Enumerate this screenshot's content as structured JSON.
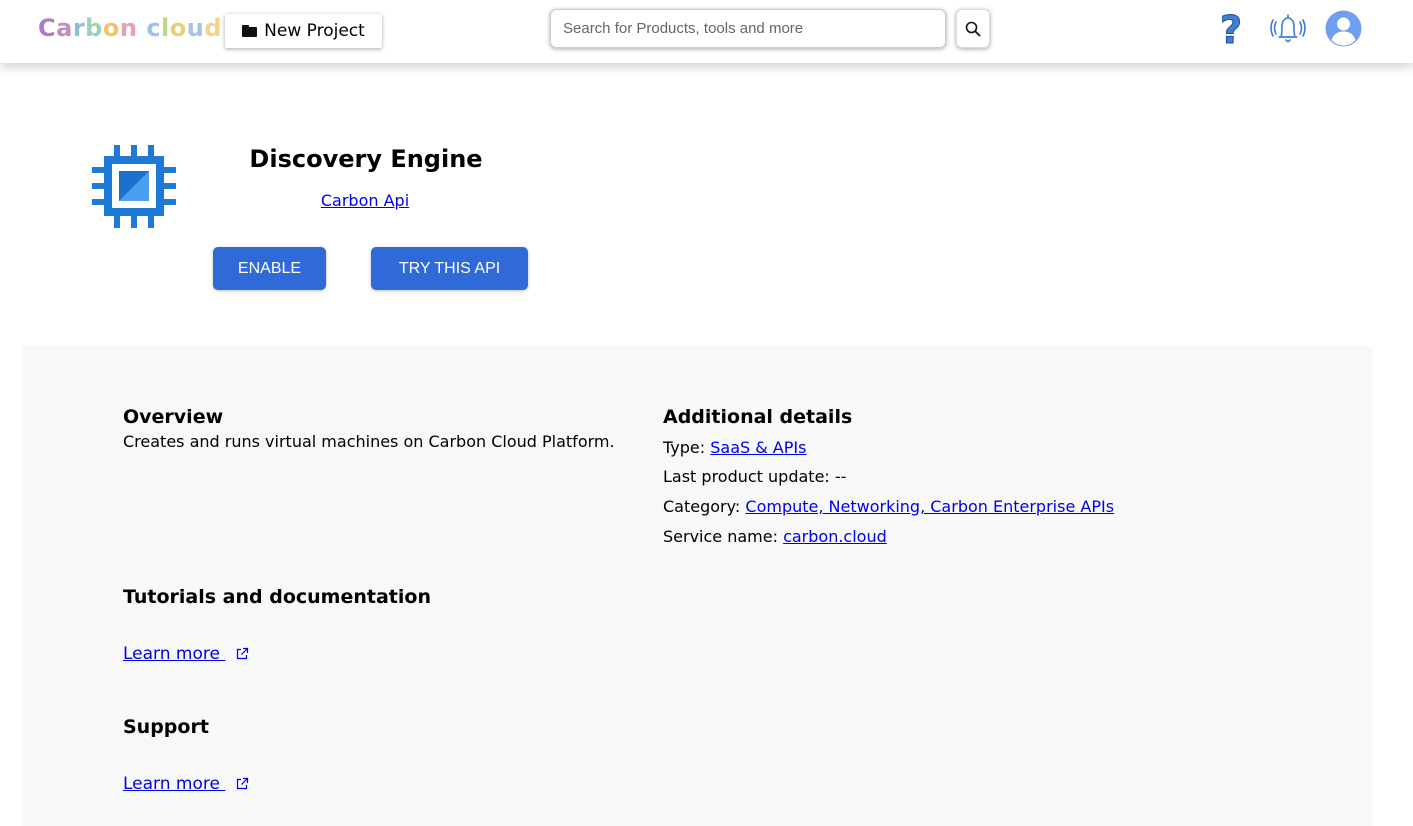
{
  "header": {
    "logo_text": "Carbon cloud",
    "logo_colors": [
      "#b07cc6",
      "#c48bb8",
      "#8fbfd9",
      "#9bd3b8",
      "#f3c26b",
      "#e9a1b0",
      "#9fc2e8",
      "#b9d98a",
      "#e3d27a",
      "#a5c4e8",
      "#f0d58a"
    ],
    "new_project_label": "New Project",
    "search_placeholder": "Search for Products, tools and more",
    "search_value": ""
  },
  "product": {
    "title": "Discovery Engine",
    "subtitle_link": "Carbon Api",
    "enable_label": "ENABLE",
    "try_label": "TRY THIS API",
    "accent": "#3069d8",
    "icon_color": "#1e7ad6"
  },
  "overview": {
    "heading": "Overview",
    "text": "Creates and runs virtual machines on Carbon Cloud Platform."
  },
  "additional": {
    "heading": "Additional details",
    "type_label": "Type: ",
    "type_value": "SaaS & APIs",
    "last_update_label": "Last product update: --",
    "category_label": "Category: ",
    "category_value": "Compute, Networking, Carbon Enterprise APIs",
    "service_label": "Service name: ",
    "service_value": "carbon.cloud"
  },
  "tutorials": {
    "heading": "Tutorials and documentation",
    "link": "Learn more "
  },
  "support": {
    "heading": "Support",
    "link": "Learn more "
  }
}
